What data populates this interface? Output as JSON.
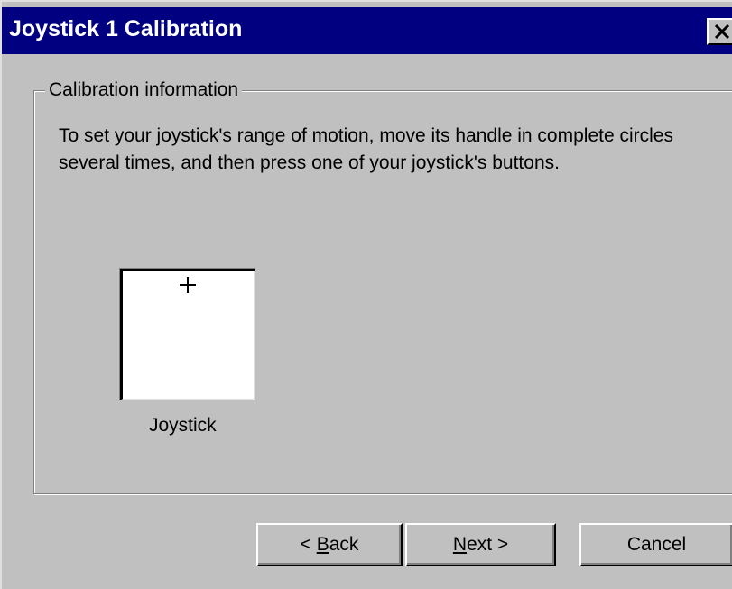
{
  "window": {
    "title": "Joystick 1 Calibration",
    "close_icon": "close-icon"
  },
  "group": {
    "label": "Calibration information",
    "instructions": "To set your joystick's range of motion, move its handle in complete circles several times, and then press one of your joystick's buttons."
  },
  "joystick": {
    "label": "Joystick",
    "crosshair_icon": "crosshair-icon"
  },
  "buttons": {
    "back": {
      "prefix": "< ",
      "mnemonic": "B",
      "rest": "ack"
    },
    "next": {
      "mnemonic": "N",
      "rest": "ext >"
    },
    "cancel": {
      "label": "Cancel"
    }
  },
  "colors": {
    "titlebar": "#000080",
    "face": "#c0c0c0",
    "shadow": "#808080",
    "highlight": "#ffffff"
  }
}
